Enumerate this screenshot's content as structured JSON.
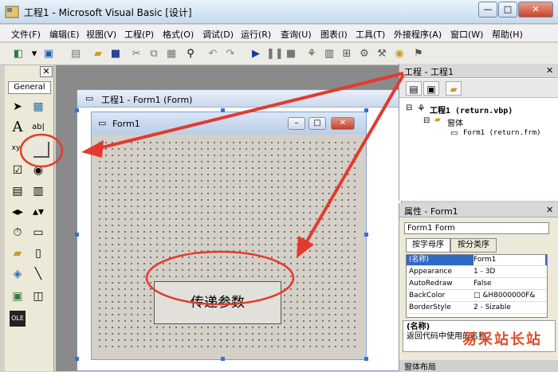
{
  "window": {
    "title": "工程1 - Microsoft Visual Basic [设计]",
    "min": "—",
    "max": "□",
    "close": "✕"
  },
  "menu": [
    "文件(F)",
    "编辑(E)",
    "视图(V)",
    "工程(P)",
    "格式(O)",
    "调试(D)",
    "运行(R)",
    "查询(U)",
    "图表(I)",
    "工具(T)",
    "外接程序(A)",
    "窗口(W)",
    "帮助(H)"
  ],
  "toolbar_icons": [
    "add-form-icon",
    "menu-editor-icon",
    "open-icon",
    "save-icon",
    "cut-icon",
    "copy-icon",
    "paste-icon",
    "find-icon",
    "undo-icon",
    "redo-icon",
    "run-icon",
    "pause-icon",
    "stop-icon",
    "project-explorer-icon",
    "properties-icon",
    "form-layout-icon",
    "object-browser-icon",
    "toolbox-icon",
    "data-view-icon",
    "visual-component-icon"
  ],
  "toolbox": {
    "close": "✕",
    "tab": "General"
  },
  "designer": {
    "title": "工程1 - Form1 (Form)"
  },
  "form": {
    "title": "Form1",
    "min": "–",
    "max": "□",
    "close": "✕",
    "button_label": "传递参数"
  },
  "project": {
    "title": "工程 - 工程1",
    "close": "✕",
    "tree": {
      "root": "工程1 (return.vbp)",
      "folder": "窗体",
      "item": "Form1 (return.frm)"
    }
  },
  "props": {
    "title": "属性 - Form1",
    "close": "✕",
    "object": "Form1 Form",
    "tabs": [
      "按字母序",
      "按分类序"
    ],
    "rows": [
      {
        "k": "(名称)",
        "v": "Form1"
      },
      {
        "k": "Appearance",
        "v": "1 - 3D"
      },
      {
        "k": "AutoRedraw",
        "v": "False"
      },
      {
        "k": "BackColor",
        "v": "□ &H8000000F&"
      },
      {
        "k": "BorderStyle",
        "v": "2 - Sizable"
      }
    ],
    "desc_title": "(名称)",
    "desc_text": "返回代码中使用的名称。"
  },
  "layout_panel": {
    "title": "窗体布局"
  },
  "watermark": "易采站长站",
  "colors": {
    "arrow": "#e23b2e",
    "selection": "#316ac5"
  }
}
